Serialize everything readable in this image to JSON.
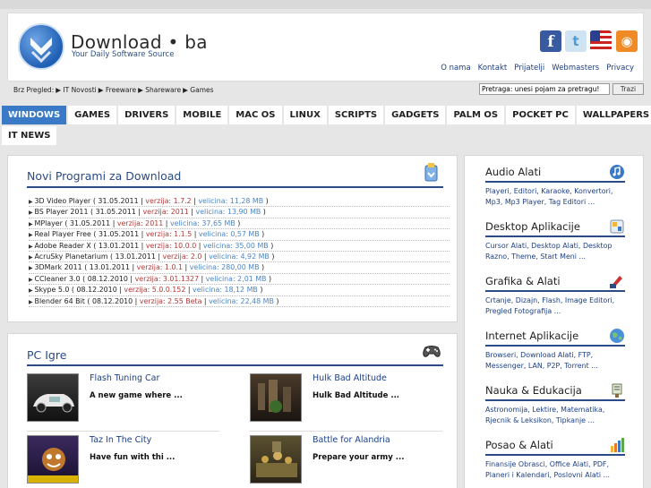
{
  "header": {
    "logo_title": "Download • ba",
    "logo_subtitle": "Your Daily Software Source",
    "social": {
      "facebook": "f",
      "twitter": "t",
      "rss": "◉"
    },
    "top_links": [
      "O nama",
      "Kontakt",
      "Prijatelji",
      "Webmasters",
      "Privacy"
    ]
  },
  "breadcrumbs": {
    "items": [
      "Brz Pregled:",
      "▶ IT Novosti",
      "▶ Freeware",
      "▶ Shareware",
      "▶ Games"
    ]
  },
  "search": {
    "value": "Pretraga: unesi pojam za pretragu!",
    "button": "Trazi"
  },
  "tabs": {
    "row1": [
      "WINDOWS",
      "GAMES",
      "DRIVERS",
      "MOBILE",
      "MAC OS",
      "LINUX",
      "SCRIPTS",
      "GADGETS",
      "PALM OS",
      "POCKET PC",
      "WALLPAPERS"
    ],
    "row2": [
      "IT NEWS"
    ],
    "active": "WINDOWS"
  },
  "new_programs": {
    "title": "Novi Programi za Download",
    "items": [
      {
        "name": "3D Video Player",
        "date": "31.05.2011",
        "version": "verzija: 1.7.2",
        "size": "velicina: 11,28 MB"
      },
      {
        "name": "BS Player 2011",
        "date": "31.05.2011",
        "version": "verzija: 2011",
        "size": "velicina: 13,90 MB"
      },
      {
        "name": "MPlayer",
        "date": "31.05.2011",
        "version": "verzija: 2011",
        "size": "velicina: 37,65 MB"
      },
      {
        "name": "Real Player Free",
        "date": "31.05.2011",
        "version": "verzija: 1.1.5",
        "size": "velicina: 0,57 MB"
      },
      {
        "name": "Adobe Reader X",
        "date": "13.01.2011",
        "version": "verzija: 10.0.0",
        "size": "velicina: 35,00 MB"
      },
      {
        "name": "AcruSky Planetarium",
        "date": "13.01.2011",
        "version": "verzija: 2.0",
        "size": "velicina: 4,92 MB"
      },
      {
        "name": "3DMark 2011",
        "date": "13.01.2011",
        "version": "verzija: 1.0.1",
        "size": "velicina: 280,00 MB"
      },
      {
        "name": "CCleaner 3.0",
        "date": "08.12.2010",
        "version": "verzija: 3.01.1327",
        "size": "velicina: 2,01 MB"
      },
      {
        "name": "Skype 5.0",
        "date": "08.12.2010",
        "version": "verzija: 5.0.0.152",
        "size": "velicina: 18,12 MB"
      },
      {
        "name": "Blender 64 Bit",
        "date": "08.12.2010",
        "version": "verzija: 2.55 Beta",
        "size": "velicina: 22,48 MB"
      }
    ]
  },
  "pc_games": {
    "title": "PC Igre",
    "items": [
      {
        "title": "Flash Tuning Car",
        "desc": "A new game where ..."
      },
      {
        "title": "Hulk Bad Altitude",
        "desc": "Hulk Bad Altitude ..."
      },
      {
        "title": "Taz In The City",
        "desc": "Have fun with thi ..."
      },
      {
        "title": "Battle for Alandria",
        "desc": "Prepare your army ..."
      }
    ]
  },
  "categories": [
    {
      "title": "Audio Alati",
      "desc": "Playeri, Editori, Karaoke, Konvertori, Mp3, Mp3 Player, Tag Editori ...",
      "icon": "music-icon"
    },
    {
      "title": "Desktop Aplikacije",
      "desc": "Cursor Alati, Desktop Alati, Desktop Razno, Theme, Start Meni ...",
      "icon": "desktop-icon"
    },
    {
      "title": "Grafika & Alati",
      "desc": "Crtanje, Dizajn, Flash, Image Editori, Pregled Fotografija ...",
      "icon": "paint-icon"
    },
    {
      "title": "Internet Aplikacije",
      "desc": "Browseri, Download Alati, FTP, Messenger, LAN, P2P, Torrent ...",
      "icon": "globe-icon"
    },
    {
      "title": "Nauka & Edukacija",
      "desc": "Astronomija, Lektire, Matematika, Rjecnik & Leksikon, Tipkanje ...",
      "icon": "science-icon"
    },
    {
      "title": "Posao & Alati",
      "desc": "Finansije Obrasci, Office Alati, PDF, Planeri i Kalendari, Poslovni Alati ...",
      "icon": "chart-icon"
    }
  ]
}
